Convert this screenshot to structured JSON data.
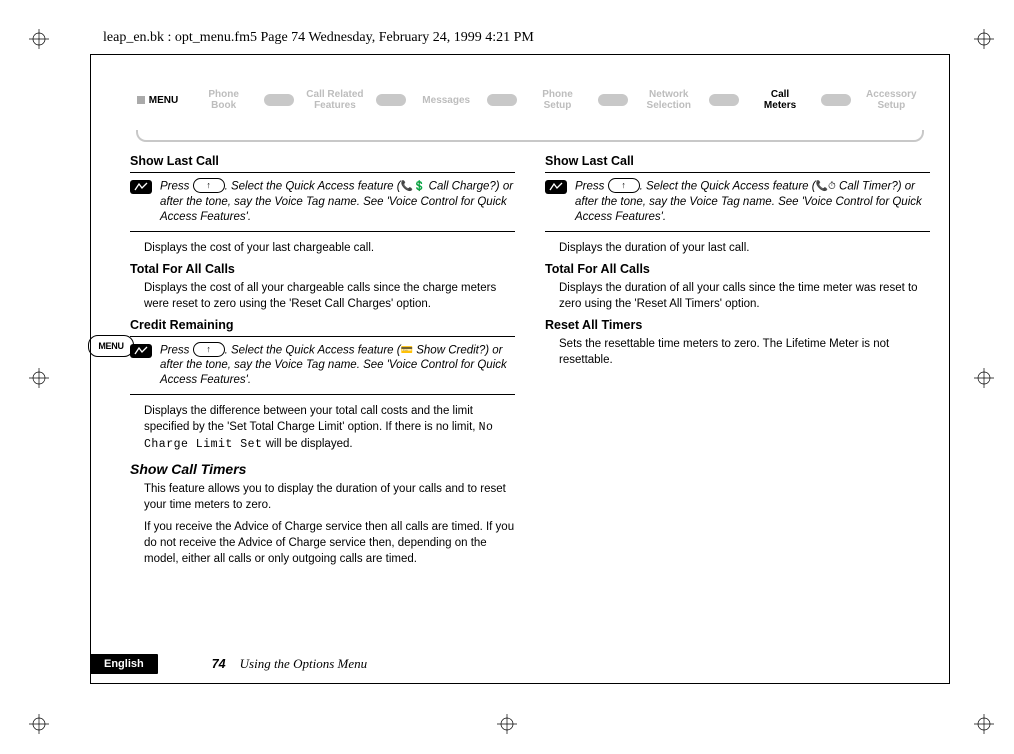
{
  "header_line": "leap_en.bk : opt_menu.fm5  Page 74  Wednesday, February 24, 1999  4:21 PM",
  "menu_label": "MENU",
  "tabs": [
    {
      "label": "Phone\nBook"
    },
    {
      "label": "Call Related\nFeatures"
    },
    {
      "label": "Messages"
    },
    {
      "label": "Phone\nSetup"
    },
    {
      "label": "Network\nSelection"
    },
    {
      "label": "Call\nMeters",
      "active": true
    },
    {
      "label": "Accessory\nSetup"
    }
  ],
  "side_menu_label": "MENU",
  "left": {
    "sec1_title": "Show Last Call",
    "note1_a": "Press ",
    "note1_btn": "↑",
    "note1_b": ". Select the Quick Access feature (",
    "note1_icon": "📞💲",
    "note1_c": " Call Charge?) or after the tone, say the Voice Tag name. See 'Voice Control for Quick Access Features'.",
    "body1": "Displays the cost of your last chargeable call.",
    "sec2_title": "Total For All Calls",
    "body2": "Displays the cost of all your chargeable calls since the charge meters were reset to zero using the 'Reset Call Charges' option.",
    "sec3_title": "Credit Remaining",
    "note2_a": "Press ",
    "note2_btn": "↑",
    "note2_b": ". Select the Quick Access feature (",
    "note2_icon": "💳",
    "note2_c": " Show Credit?) or after the tone, say the Voice Tag name. See 'Voice Control for Quick Access Features'.",
    "body3_a": "Displays the difference between your total call costs and the limit specified by the 'Set Total Charge Limit' option. If there is no limit, ",
    "body3_mono": "No Charge Limit Set",
    "body3_b": " will be displayed.",
    "subsec_title": "Show Call Timers",
    "body4": "This feature allows you to display the duration of your calls and to reset your time meters to zero.",
    "body5": "If you receive the Advice of Charge service then all calls are timed. If you do not receive the Advice of Charge service then, depending on the model, either all calls or only outgoing calls are timed."
  },
  "right": {
    "sec1_title": "Show Last Call",
    "note1_a": "Press ",
    "note1_btn": "↑",
    "note1_b": ". Select the Quick Access feature (",
    "note1_icon": "📞⏱",
    "note1_c": " Call Timer?) or after the tone, say the Voice Tag name. See 'Voice Control for Quick Access Features'.",
    "body1": "Displays the duration of your last call.",
    "sec2_title": "Total For All Calls",
    "body2": "Displays the duration of all your calls since the time meter was reset to zero using the 'Reset All Timers' option.",
    "sec3_title": "Reset All Timers",
    "body3": "Sets the resettable time meters to zero. The Lifetime Meter is not resettable."
  },
  "footer": {
    "lang": "English",
    "page": "74",
    "title": "Using the Options Menu"
  }
}
